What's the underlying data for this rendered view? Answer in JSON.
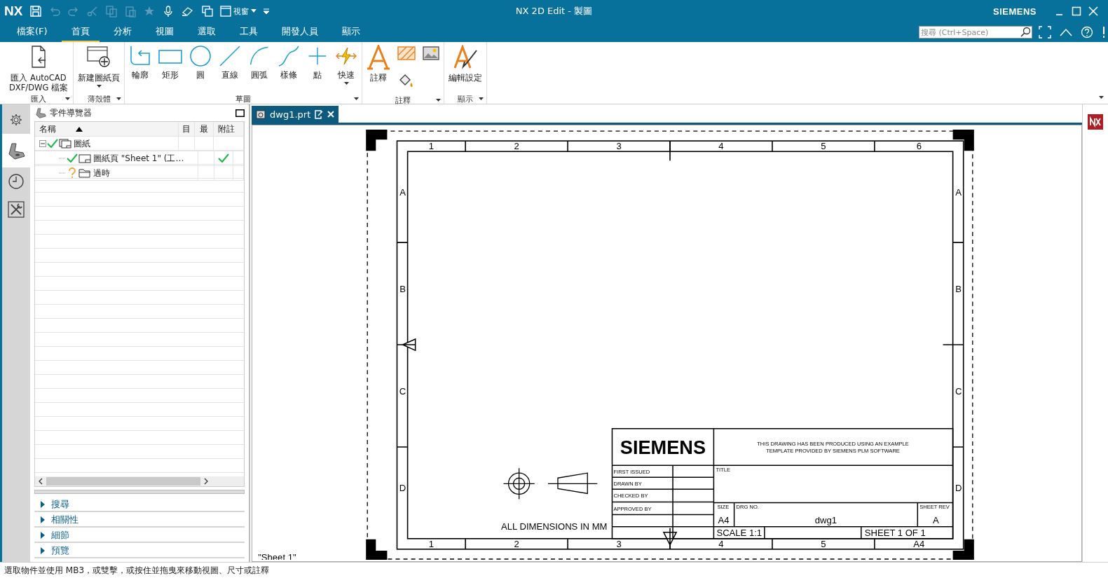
{
  "window": {
    "logo": "NX",
    "title": "NX 2D Edit - 製圖",
    "brand": "SIEMENS",
    "view_menu": "視窗"
  },
  "menu_tabs": [
    {
      "label": "檔案(F)",
      "selected": false
    },
    {
      "label": "首頁",
      "selected": true
    },
    {
      "label": "分析",
      "selected": false
    },
    {
      "label": "視圖",
      "selected": false
    },
    {
      "label": "選取",
      "selected": false
    },
    {
      "label": "工具",
      "selected": false
    },
    {
      "label": "開發人員",
      "selected": false
    },
    {
      "label": "顯示",
      "selected": false
    }
  ],
  "search": {
    "placeholder": "搜尋 (Ctrl+Space)"
  },
  "ribbon": [
    {
      "label": "匯入",
      "commands": [
        {
          "kind": "import",
          "label": "匯入 AutoCAD DXF/DWG 檔案",
          "menu": false
        }
      ]
    },
    {
      "label": "薄殼體",
      "commands": [
        {
          "kind": "new-sheet",
          "label": "新建圖紙頁",
          "menu": true
        }
      ]
    },
    {
      "label": "草圖",
      "commands": [
        {
          "kind": "profile",
          "label": "輪廓",
          "menu": false
        },
        {
          "kind": "rectangle",
          "label": "矩形",
          "menu": false
        },
        {
          "kind": "circle",
          "label": "圓",
          "menu": false
        },
        {
          "kind": "line",
          "label": "直線",
          "menu": false
        },
        {
          "kind": "arc",
          "label": "圓弧",
          "menu": false
        },
        {
          "kind": "spline",
          "label": "樣條",
          "menu": false
        },
        {
          "kind": "point",
          "label": "點",
          "menu": false
        },
        {
          "kind": "quick",
          "label": "快速",
          "menu": true
        }
      ]
    },
    {
      "label": "註釋",
      "commands": [
        {
          "kind": "note",
          "label": "註釋",
          "menu": false
        },
        {
          "kind": "hatch",
          "menu": false
        },
        {
          "kind": "image",
          "menu": false
        },
        {
          "kind": "fill",
          "menu": false
        }
      ]
    },
    {
      "label": "顯示",
      "commands": [
        {
          "kind": "edit-settings",
          "label": "編輯設定",
          "menu": false
        }
      ]
    }
  ],
  "side_tabs": [
    {
      "kind": "settings",
      "selected": false
    },
    {
      "kind": "part",
      "selected": true
    },
    {
      "kind": "history",
      "selected": false
    },
    {
      "kind": "tools",
      "selected": false
    }
  ],
  "navigator": {
    "title": "零件導覽器",
    "columns": [
      "名稱",
      "目",
      "最",
      "附註"
    ],
    "tree": [
      {
        "name": "圖紙",
        "kind": "drawing-group",
        "current": true,
        "expanded": true,
        "latest": false,
        "children": [
          {
            "name": "圖紙頁 \"Sheet 1\" (工…",
            "kind": "sheet",
            "current": true,
            "latest": true
          },
          {
            "name": "過時",
            "kind": "folder",
            "current": false,
            "latest": false
          }
        ]
      }
    ],
    "panels": [
      {
        "label": "搜尋",
        "expanded": false
      },
      {
        "label": "相關性",
        "expanded": false
      },
      {
        "label": "細節",
        "expanded": false
      },
      {
        "label": "預覽",
        "expanded": false
      }
    ]
  },
  "document_tab": {
    "label": "dwg1.prt",
    "selected": true
  },
  "drawing": {
    "sheet_label": "\"Sheet 1\"",
    "top_zones": [
      "1",
      "2",
      "3",
      "4",
      "5",
      "6"
    ],
    "bottom_zones": [
      "1",
      "2",
      "3",
      "4",
      "5",
      "A4"
    ],
    "left_zones": [
      "A",
      "B",
      "C",
      "D"
    ],
    "right_zones": [
      "A",
      "B",
      "C",
      "D"
    ],
    "dimension_note": "ALL DIMENSIONS IN MM",
    "title_block": {
      "logo": "SIEMENS",
      "notice_lines": [
        "THIS DRAWING HAS BEEN PRODUCED USING AN EXAMPLE",
        "TEMPLATE PROVIDED BY SIEMENS PLM SOFTWARE"
      ],
      "approvals": [
        "FIRST ISSUED",
        "DRAWN BY",
        "CHECKED BY",
        "APPROVED BY"
      ],
      "title_label": "TITLE",
      "size_label": "SIZE",
      "size": "A4",
      "drg_no_label": "DRG NO.",
      "drg_no": "dwg1",
      "rev_label": "SHEET REV",
      "rev": "A",
      "scale": "SCALE 1:1",
      "sheet": "SHEET 1 OF 1"
    }
  },
  "status_bar": "選取物件並使用 MB3，或雙擊，或按住並拖曳來移動視圖、尺寸或註釋"
}
